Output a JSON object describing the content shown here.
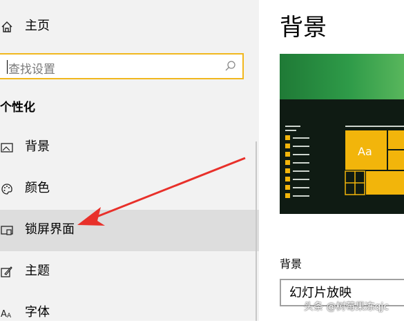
{
  "sidebar": {
    "home_label": "主页",
    "search_placeholder": "查找设置",
    "section_title": "个性化",
    "items": [
      {
        "label": "背景",
        "icon": "picture-icon"
      },
      {
        "label": "颜色",
        "icon": "palette-icon"
      },
      {
        "label": "锁屏界面",
        "icon": "lock-screen-icon"
      },
      {
        "label": "主题",
        "icon": "theme-brush-icon"
      },
      {
        "label": "字体",
        "icon": "font-icon"
      }
    ],
    "selected_index": 2
  },
  "main": {
    "page_title": "背景",
    "preview_tile_label": "Aa",
    "background_label": "背景",
    "background_select_value": "幻灯片放映"
  },
  "watermark": "头条 @树莓果冻qjc",
  "colors": {
    "accent": "#f1b71d",
    "annotation_arrow": "#e8302a",
    "tile": "#f2b50b",
    "banner": "#2e9a48"
  }
}
